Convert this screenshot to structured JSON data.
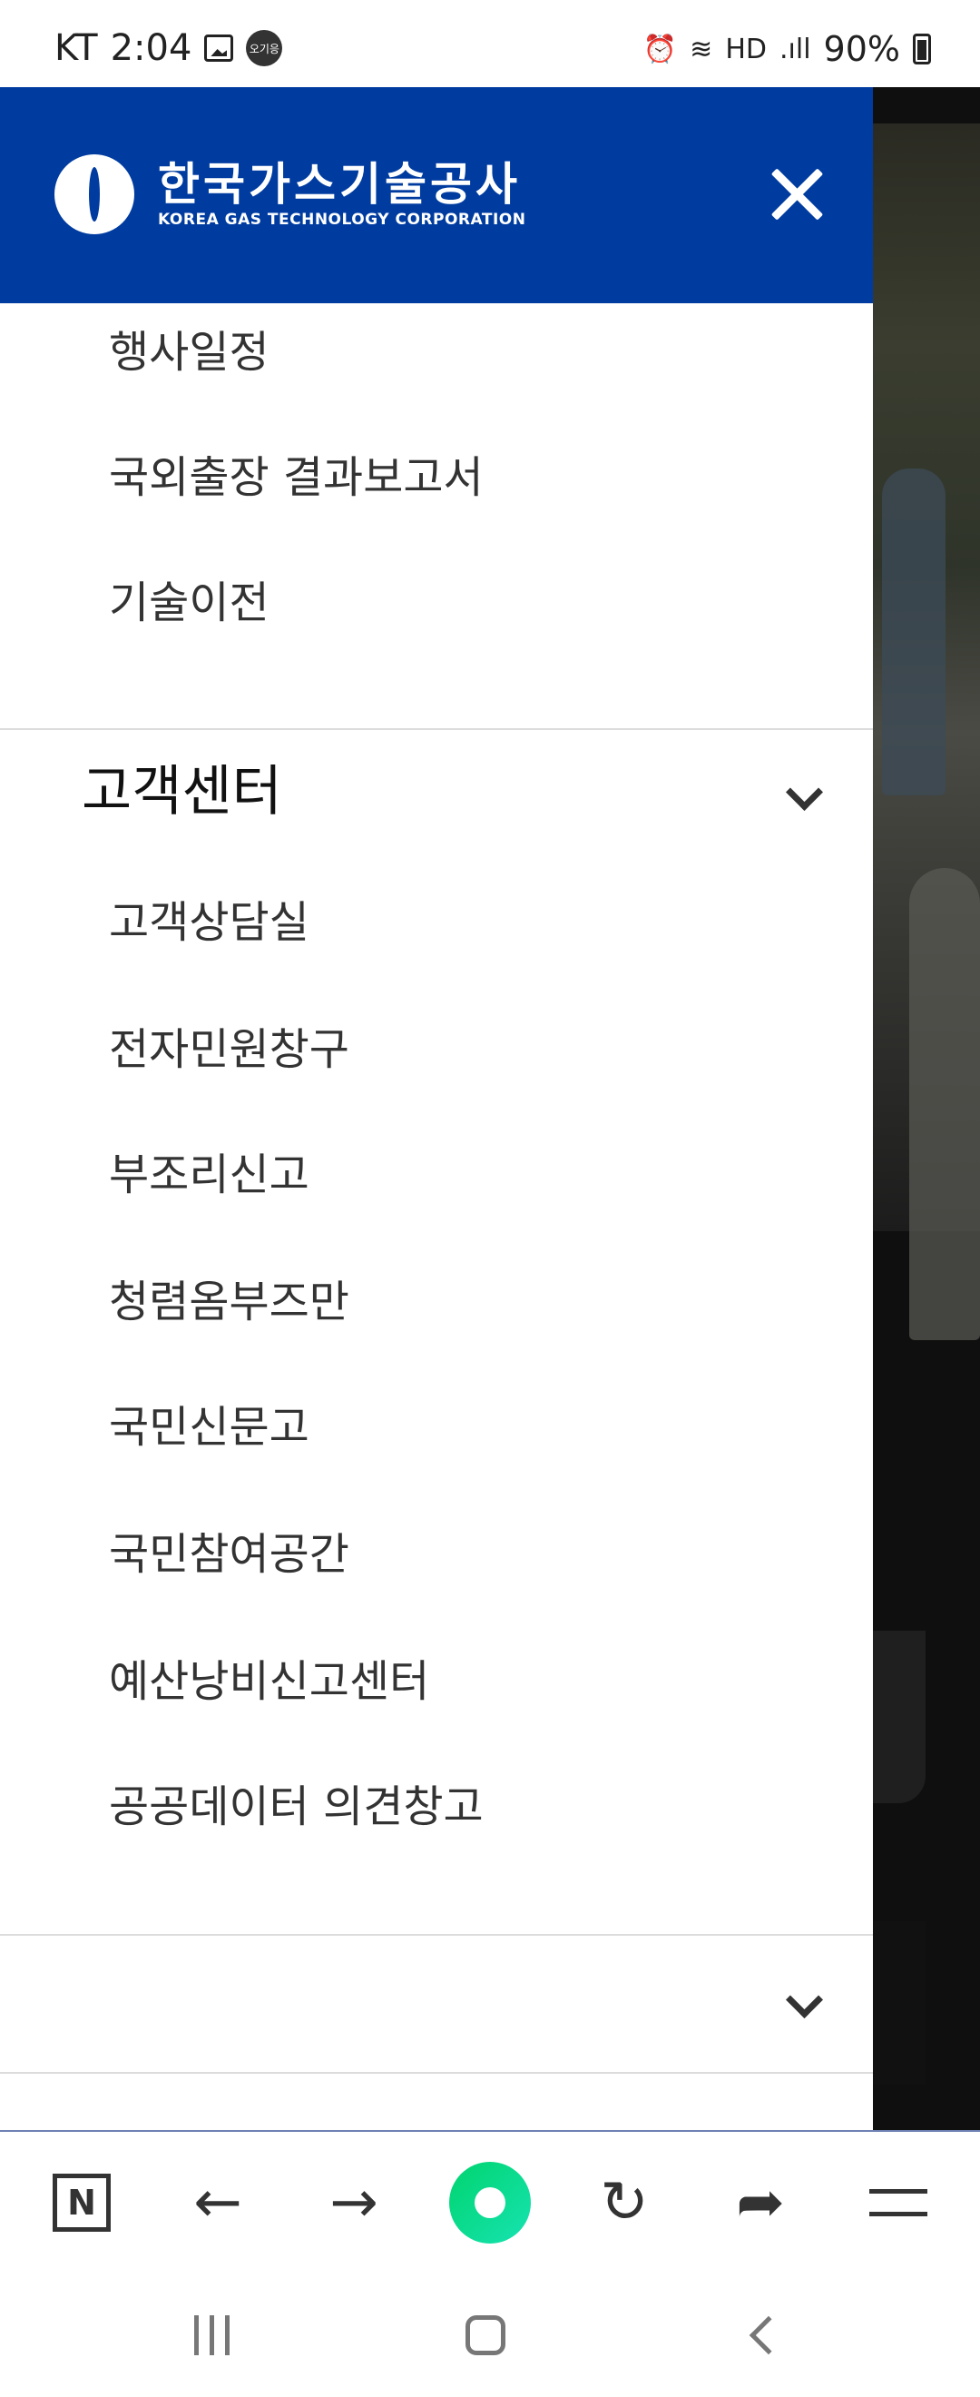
{
  "status_bar": {
    "carrier": "KT",
    "time": "2:04",
    "badge_text": "오기응",
    "battery": "90%"
  },
  "drawer": {
    "logo": {
      "name_ko": "한국가스기술공사",
      "name_en": "KOREA GAS TECHNOLOGY CORPORATION"
    },
    "top_items": [
      "행사일정",
      "국외출장 결과보고서",
      "기술이전"
    ],
    "section": {
      "title": "고객센터",
      "items": [
        "고객상담실",
        "전자민원창구",
        "부조리신고",
        "청렴옴부즈만",
        "국민신문고",
        "국민참여공간",
        "예산낭비신고센터",
        "공공데이터 의견창고"
      ]
    },
    "next_section": {
      "title": ""
    }
  },
  "browser_toolbar": {
    "icons": [
      "naver-n-icon",
      "back-arrow-icon",
      "forward-arrow-icon",
      "green-dot-icon",
      "refresh-icon",
      "share-icon",
      "menu-icon"
    ]
  },
  "colors": {
    "header_blue": "#003ca0",
    "green_button": "#00d46e"
  }
}
